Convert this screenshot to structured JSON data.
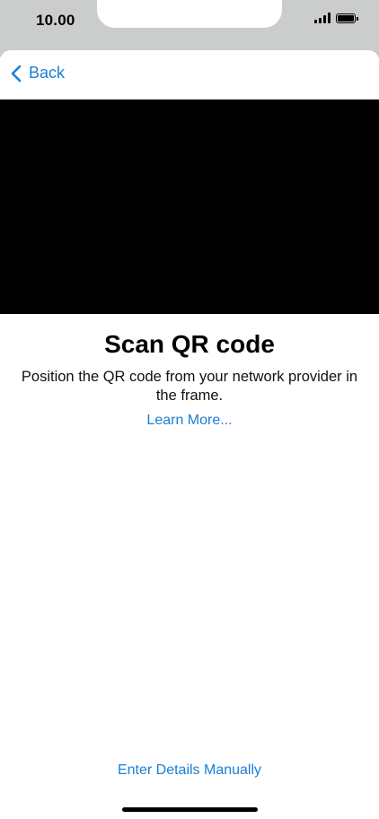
{
  "status_bar": {
    "time": "10.00"
  },
  "nav": {
    "back_label": "Back",
    "back_icon": "chevron-left-icon"
  },
  "main": {
    "title": "Scan QR code",
    "subtitle": "Position the QR code from your network provider in the frame.",
    "learn_more": "Learn More..."
  },
  "footer": {
    "enter_manually": "Enter Details Manually"
  },
  "colors": {
    "accent": "#1a7fd4",
    "bezel": "#cbcdcc",
    "camera": "#000000"
  }
}
